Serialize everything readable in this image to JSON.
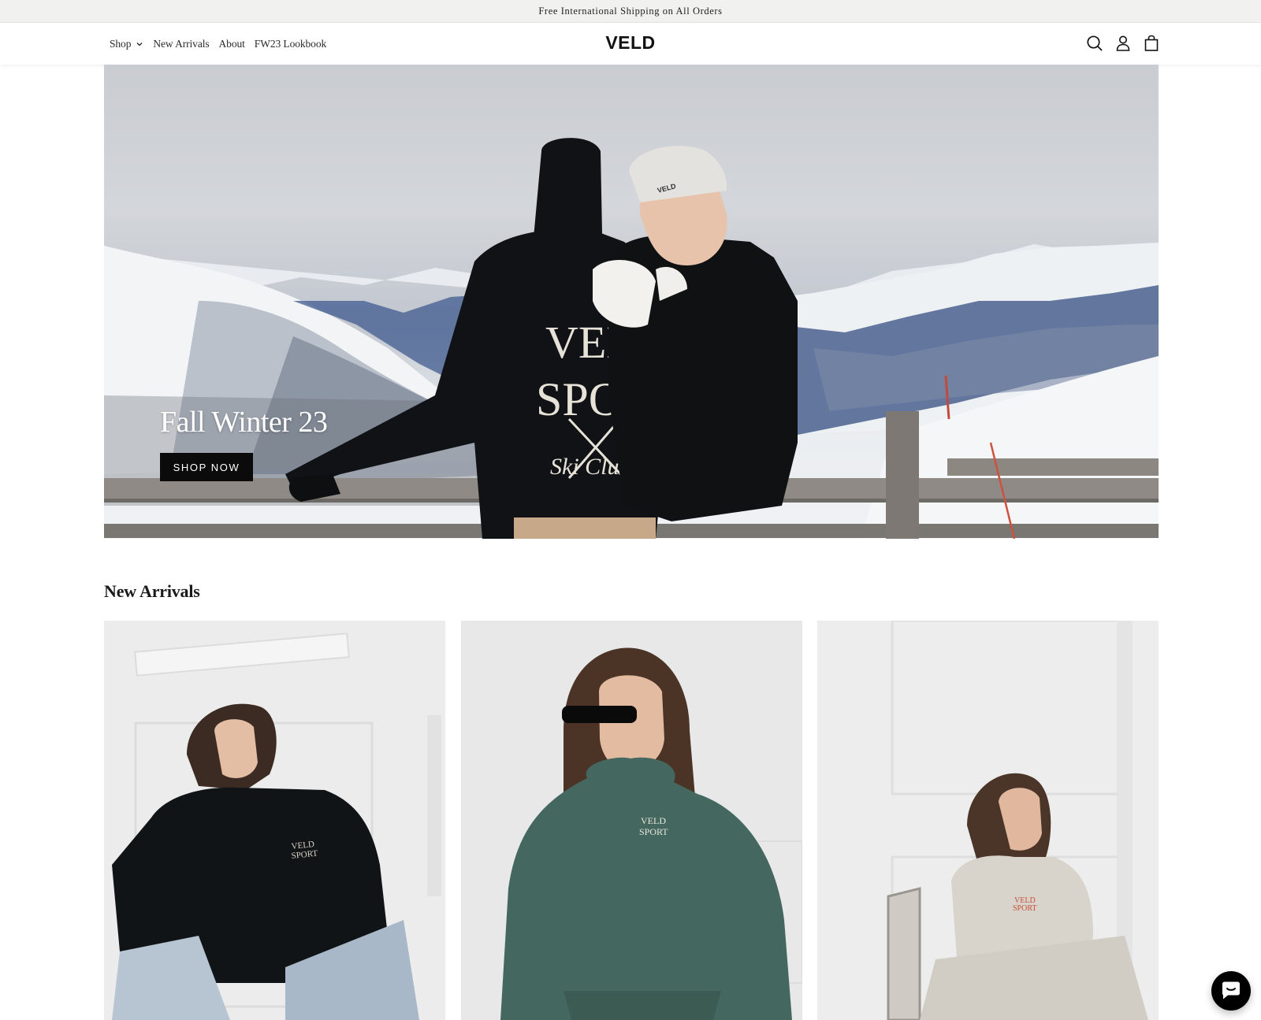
{
  "announcement": {
    "text": "Free International Shipping on All Orders"
  },
  "header": {
    "nav": [
      {
        "label": "Shop",
        "has_dropdown": true
      },
      {
        "label": "New Arrivals"
      },
      {
        "label": "About"
      },
      {
        "label": "FW23 Lookbook"
      }
    ],
    "logo": "VELD",
    "icons": [
      "search-icon",
      "account-icon",
      "cart-icon"
    ]
  },
  "hero": {
    "title": "Fall Winter 23",
    "button_label": "SHOP NOW",
    "hoodie_back_print": [
      "VELD",
      "SPORT",
      "Ski Club"
    ],
    "beanie_label": "VELD"
  },
  "new_arrivals": {
    "title": "New Arrivals",
    "products": [
      {
        "hoodie_color": "#111416",
        "print": [
          "VELD",
          "SPORT"
        ],
        "print_color": "#d9d4c9"
      },
      {
        "hoodie_color": "#44685f",
        "print": [
          "VELD",
          "SPORT"
        ],
        "print_color": "#e8e4da"
      },
      {
        "hoodie_color": "#d8d3cb",
        "print": [
          "VELD",
          "SPORT"
        ],
        "print_color": "#c8503a"
      }
    ]
  },
  "chat": {
    "icon": "chat-icon"
  },
  "colors": {
    "announce_bg": "#f1f1ef",
    "button_bg": "#0b0b0b",
    "text": "#121212"
  }
}
